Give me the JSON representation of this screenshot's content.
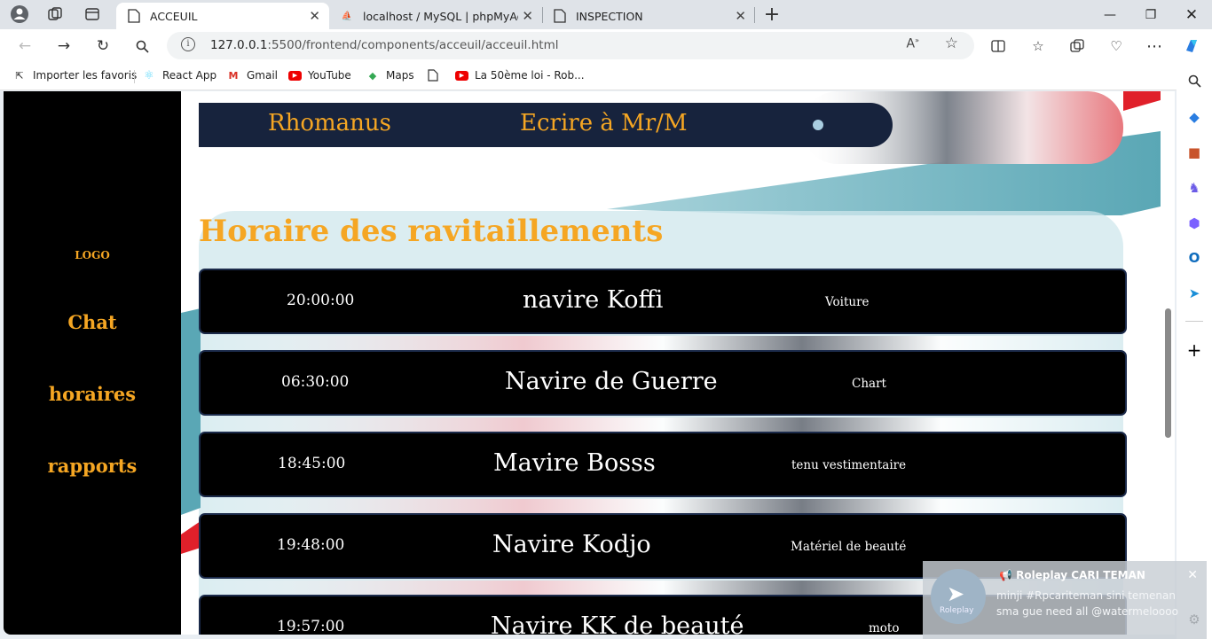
{
  "browser": {
    "tabs": [
      {
        "title": "ACCEUIL",
        "active": true
      },
      {
        "title": "localhost / MySQL | phpMyAdmin",
        "active": false
      },
      {
        "title": "INSPECTION",
        "active": false
      }
    ],
    "address": {
      "host": "127.0.0.1",
      "path": ":5500/frontend/components/acceuil/acceuil.html"
    },
    "bookmarks": [
      {
        "label": "Importer les favoris",
        "icon": "import-icon"
      },
      {
        "label": "React App",
        "icon": "react-icon"
      },
      {
        "label": "Gmail",
        "icon": "gmail-icon"
      },
      {
        "label": "YouTube",
        "icon": "youtube-icon"
      },
      {
        "label": "Maps",
        "icon": "maps-icon"
      },
      {
        "label": "",
        "icon": "document-icon"
      },
      {
        "label": "La 50ème loi - Rob...",
        "icon": "youtube-icon"
      }
    ]
  },
  "sidebar": {
    "logo": "LOGO",
    "links": [
      "Chat",
      "horaires",
      "rapports"
    ]
  },
  "topbar": {
    "name": "Rhomanus",
    "write_label": "Ecrire à Mr/M"
  },
  "heading": "Horaire des ravitaillements",
  "schedule": [
    {
      "time": "20:00:00",
      "name": "navire Koffi",
      "category": "Voiture"
    },
    {
      "time": "06:30:00",
      "name": "Navire de Guerre",
      "category": "Chart"
    },
    {
      "time": "18:45:00",
      "name": "Mavire Bosss",
      "category": "tenu vestimentaire"
    },
    {
      "time": "19:48:00",
      "name": "Navire Kodjo",
      "category": "Matériel de beauté"
    },
    {
      "time": "19:57:00",
      "name": "Navire KK de beauté",
      "category": "moto"
    }
  ],
  "notification": {
    "title": "Roleplay CARI TEMAN",
    "line1": "minji #Rpcariteman  sini temenan",
    "line2": "sma gue need all  @watermeloooo",
    "avatar_caption": "Roleplay"
  },
  "colors": {
    "accent": "#f5a623",
    "topbar": "#17233d",
    "card": "#000000",
    "teal": "#5aa7b5",
    "red": "#e0202a"
  }
}
